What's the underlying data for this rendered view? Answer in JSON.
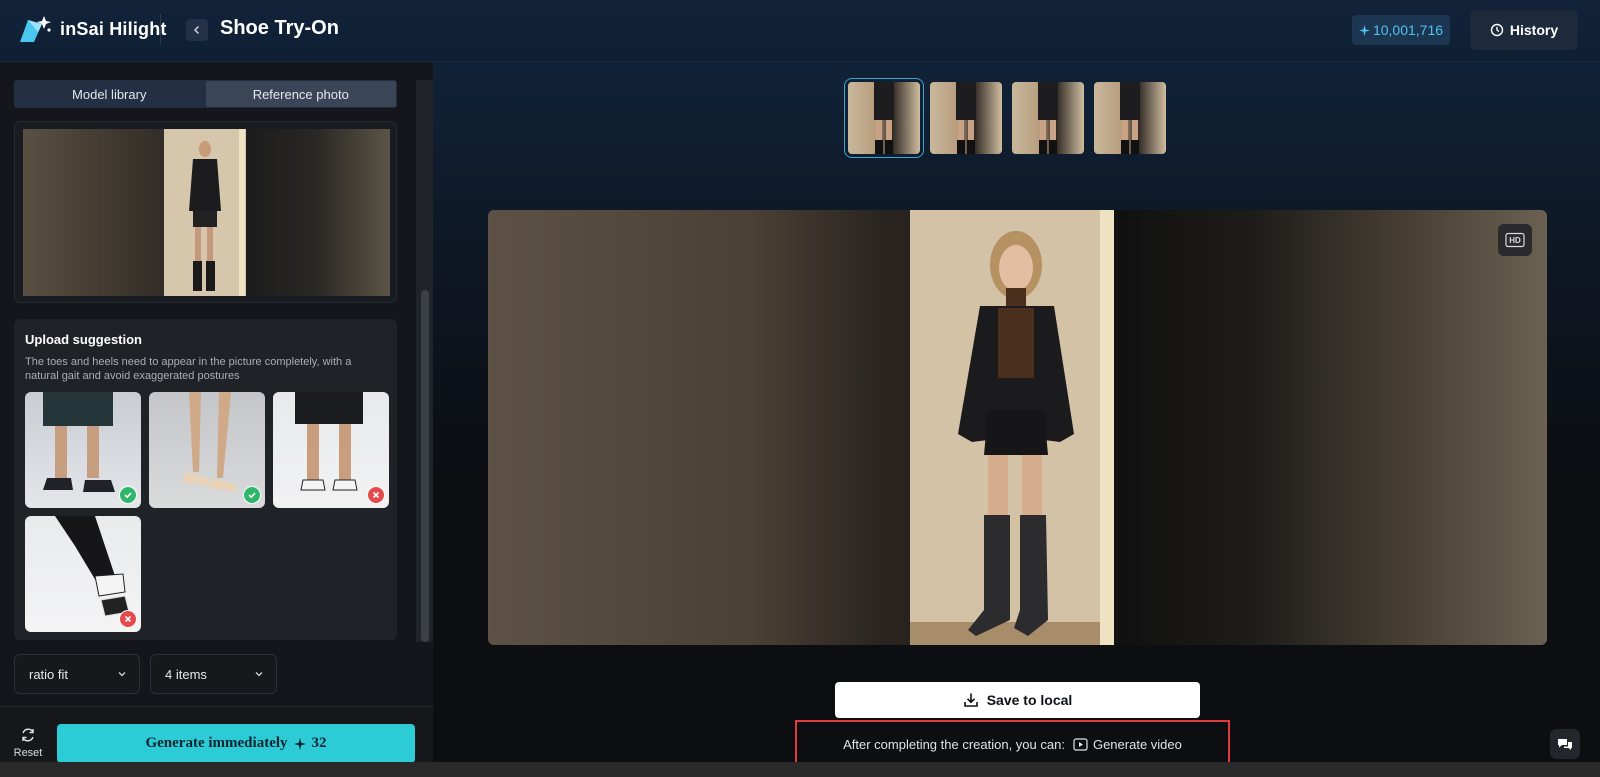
{
  "app": {
    "brand_name": "inSai Hilight",
    "page_title": "Shoe Try-On",
    "credits": "10,001,716",
    "history_label": "History"
  },
  "left_panel": {
    "tabs": [
      {
        "label": "Model library",
        "active": false
      },
      {
        "label": "Reference photo",
        "active": true
      }
    ],
    "upload_suggestion": {
      "title": "Upload suggestion",
      "description": "The toes and heels need to appear in the picture completely, with a natural gait and avoid exaggerated postures",
      "examples": [
        {
          "status": "ok",
          "icon": "check-icon"
        },
        {
          "status": "ok",
          "icon": "check-icon"
        },
        {
          "status": "bad",
          "icon": "cross-icon"
        },
        {
          "status": "bad",
          "icon": "cross-icon"
        }
      ]
    },
    "ratio_select": "ratio fit",
    "count_select": "4 items",
    "reset_label": "Reset",
    "generate_label": "Generate immediately",
    "generate_cost": "32"
  },
  "main": {
    "thumbnails_count": 4,
    "selected_thumbnail": 0,
    "hd_label": "HD",
    "save_label": "Save to local",
    "after_text": "After completing the creation, you can:",
    "generate_video_label": "Generate video"
  },
  "colors": {
    "accent": "#2ccbd5",
    "credit_text": "#4fc3ef",
    "ok": "#2fb66a",
    "bad": "#e5484d",
    "highlight_border": "#e0393e"
  }
}
